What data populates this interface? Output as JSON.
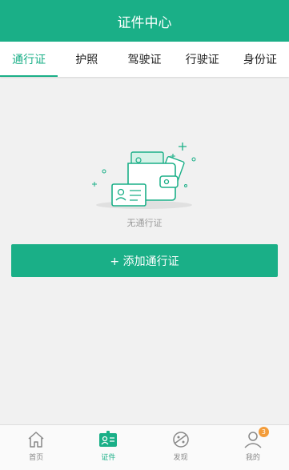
{
  "header": {
    "title": "证件中心"
  },
  "tabs": [
    {
      "label": "通行证",
      "active": true
    },
    {
      "label": "护照"
    },
    {
      "label": "驾驶证"
    },
    {
      "label": "行驶证"
    },
    {
      "label": "身份证"
    }
  ],
  "empty_state": {
    "message": "无通行证"
  },
  "add_button": {
    "label": "+ 添加通行证"
  },
  "bottom_nav": {
    "items": [
      {
        "label": "首页",
        "icon": "home-icon"
      },
      {
        "label": "证件",
        "icon": "id-card-icon",
        "active": true
      },
      {
        "label": "发现",
        "icon": "planet-icon"
      },
      {
        "label": "我的",
        "icon": "user-icon",
        "badge": "3"
      }
    ]
  },
  "colors": {
    "accent": "#1aaf87",
    "badge": "#f39c3a"
  }
}
